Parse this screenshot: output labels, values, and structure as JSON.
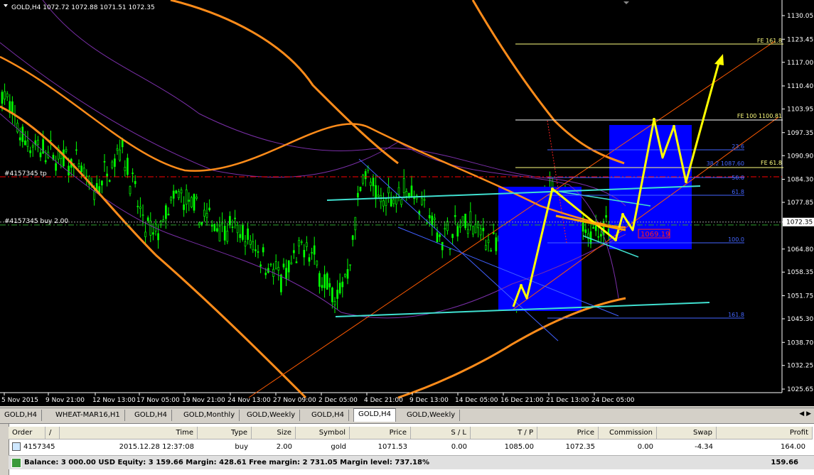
{
  "chart": {
    "header": "GOLD,H4  1072.72 1072.88 1071.51 1072.35",
    "price_ticks": [
      "1130.05",
      "1123.45",
      "1117.00",
      "1110.40",
      "1103.95",
      "1097.35",
      "1090.90",
      "1084.30",
      "1077.85",
      "1072.35",
      "1064.80",
      "1058.35",
      "1051.75",
      "1045.30",
      "1038.70",
      "1032.25",
      "1025.65"
    ],
    "current_price_label": "1072.35",
    "time_ticks": [
      "5 Nov 2015",
      "9 Nov 21:00",
      "12 Nov 13:00",
      "17 Nov 05:00",
      "19 Nov 21:00",
      "24 Nov 13:00",
      "27 Nov 09:00",
      "2 Dec 05:00",
      "4 Dec 21:00",
      "9 Dec 13:00",
      "14 Dec 05:00",
      "16 Dec 21:00",
      "21 Dec 13:00",
      "24 Dec 05:00"
    ],
    "order_labels": {
      "tp": "#4157345 tp",
      "buy": "#4157345 buy 2.00"
    },
    "fib_labels": {
      "fe_161": "FE 161.8",
      "fe_100": "FE 100 1100.81",
      "fe_61": "FE 61.8",
      "f236": "23.6",
      "f382": "38.2 1087.60",
      "f50": "50.0",
      "f618": "61.8",
      "f100": "100.0",
      "f1618": "161.8"
    },
    "red_price_label": "1069.19",
    "colors": {
      "background": "#000000",
      "candle_bull": "#00ff00",
      "ma_orange": "#ff8c1a",
      "fib_line": "#4466ff",
      "box": "#0000ff",
      "arrows": "#ffff00",
      "channel": "#40e0d0",
      "purple": "#7a2fa8",
      "tp_line": "#ff0000"
    }
  },
  "tabs": {
    "items": [
      "GOLD,H4",
      "WHEAT-MAR16,H1",
      "GOLD,H4",
      "GOLD,Monthly",
      "GOLD,Weekly",
      "GOLD,H4",
      "GOLD,H4",
      "GOLD,Weekly"
    ],
    "active_index": 6
  },
  "terminal": {
    "headers": [
      "Order",
      "/",
      "Time",
      "Type",
      "Size",
      "Symbol",
      "Price",
      "S / L",
      "T / P",
      "Price",
      "Commission",
      "Swap",
      "Profit"
    ],
    "row": {
      "order": "4157345",
      "time": "2015.12.28 12:37:08",
      "type": "buy",
      "size": "2.00",
      "symbol": "gold",
      "price": "1071.53",
      "sl": "0.00",
      "tp": "1085.00",
      "cur_price": "1072.35",
      "commission": "0.00",
      "swap": "-4.34",
      "profit": "164.00"
    },
    "balance_text": "Balance: 3 000.00 USD  Equity: 3 159.66  Margin: 428.61  Free margin: 2 731.05  Margin level: 737.18%",
    "balance_profit": "159.66"
  }
}
